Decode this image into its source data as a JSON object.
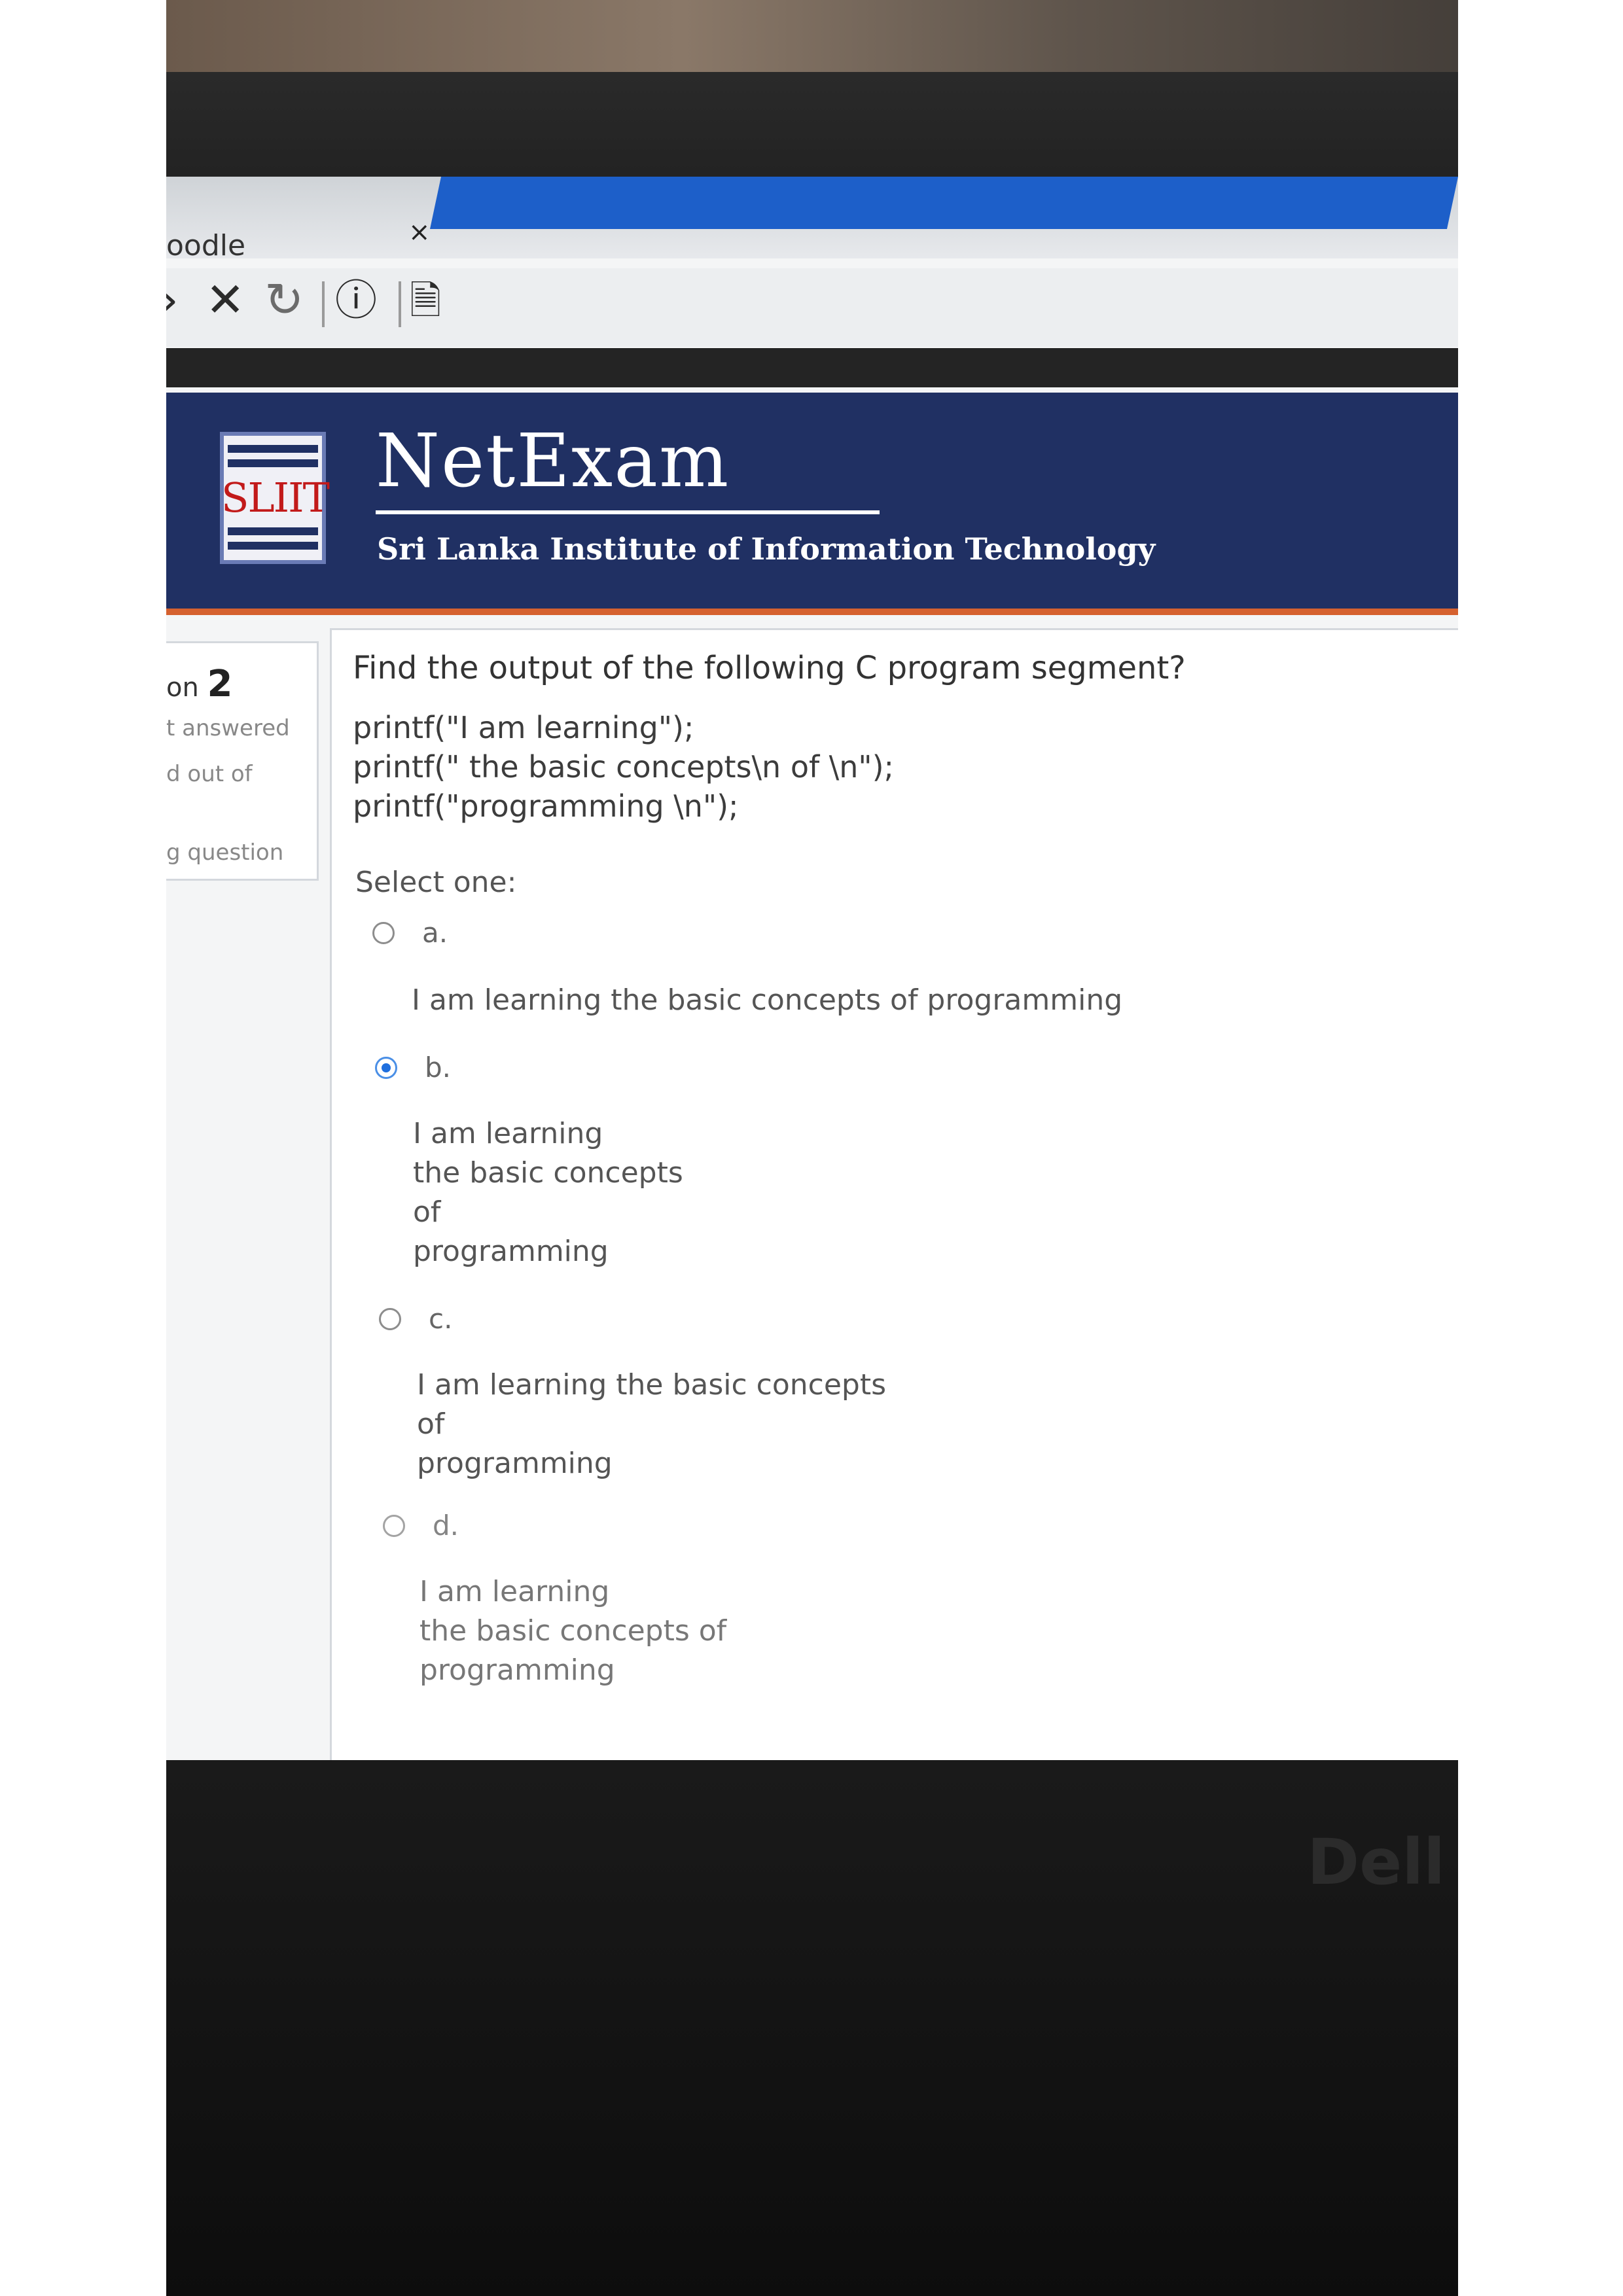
{
  "browser": {
    "tab_title": "oodle",
    "tab_close": "×"
  },
  "header": {
    "brand": "NetExam",
    "subtitle": "Sri Lanka Institute of Information Technology",
    "logo_text": "SLIIT"
  },
  "question_info": {
    "title_prefix": "on",
    "number": "2",
    "status": "t answered",
    "marks": "d out of",
    "flag": "g question"
  },
  "question": {
    "text": "Find the output of the following C program segment?",
    "code": [
      "printf(\"I am learning\");",
      "printf(\" the basic concepts\\n of \\n\");",
      "printf(\"programming \\n\");"
    ],
    "select_label": "Select one:",
    "options": [
      {
        "letter": "a.",
        "text": "I am learning the basic concepts of programming",
        "selected": false
      },
      {
        "letter": "b.",
        "text": "I am learning\nthe basic concepts\nof\nprogramming",
        "selected": true
      },
      {
        "letter": "c.",
        "text": "I am learning the basic concepts\nof\nprogramming",
        "selected": false
      },
      {
        "letter": "d.",
        "text": "I am learning\nthe basic concepts of\nprogramming",
        "selected": false
      }
    ]
  },
  "device": {
    "brand": "Dell"
  }
}
